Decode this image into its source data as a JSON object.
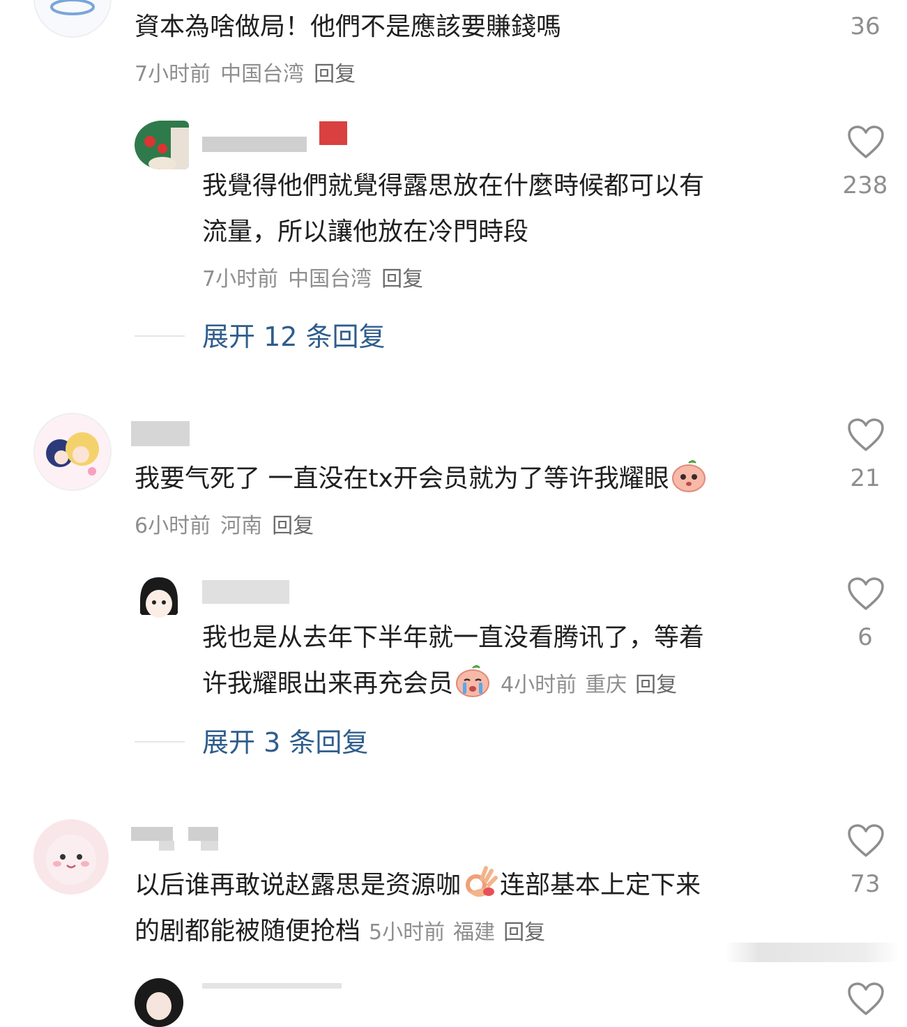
{
  "comments": [
    {
      "text": "資本為啥做局！他們不是應該要賺錢嗎",
      "time": "7小时前",
      "location": "中国台湾",
      "reply": "回复",
      "likes": "36",
      "reply_item": {
        "lines": [
          "我覺得他們就覺得露思放在什麼時候都可以有",
          "流量，所以讓他放在冷門時段"
        ],
        "time": "7小时前",
        "location": "中国台湾",
        "reply": "回复",
        "likes": "238"
      },
      "expand": "展开 12 条回复"
    },
    {
      "text": "我要气死了 一直没在tx开会员就为了等许我耀眼",
      "time": "6小时前",
      "location": "河南",
      "reply": "回复",
      "likes": "21",
      "reply_item": {
        "lines": [
          "我也是从去年下半年就一直没看腾讯了，等着",
          "许我耀眼出来再充会员"
        ],
        "time": "4小时前",
        "location": "重庆",
        "reply": "回复",
        "likes": "6"
      },
      "expand": "展开 3 条回复"
    },
    {
      "lines": [
        "以后谁再敢说赵露思是资源咖",
        "连部基本上定下来",
        "的剧都能被随便抢档"
      ],
      "time": "5小时前",
      "location": "福建",
      "reply": "回复",
      "likes": "73"
    }
  ],
  "icons": {
    "like": "heart-outline-icon"
  },
  "colors": {
    "link": "#2f5d8c",
    "meta": "#8e8e8e",
    "text": "#1f1f1f"
  }
}
